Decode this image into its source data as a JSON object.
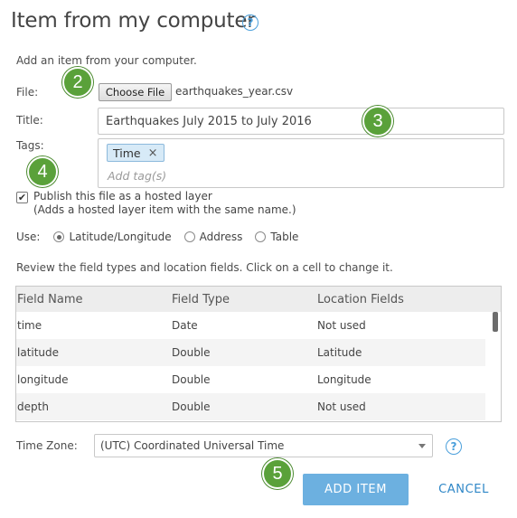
{
  "dialog": {
    "title": "Item from my computer",
    "help_glyph": "?",
    "intro": "Add an item from your computer."
  },
  "file": {
    "label": "File:",
    "button_label": "Choose File",
    "file_name": "earthquakes_year.csv"
  },
  "title_field": {
    "label": "Title:",
    "value": "Earthquakes July 2015 to July 2016"
  },
  "tags": {
    "label": "Tags:",
    "items": [
      {
        "label": "Time",
        "remove_glyph": "×"
      }
    ],
    "placeholder": "Add tag(s)"
  },
  "publish": {
    "checked": true,
    "check_glyph": "✔",
    "line1": "Publish this file as a hosted layer",
    "line2": "(Adds a hosted layer item with the same name.)"
  },
  "use": {
    "label": "Use:",
    "options": [
      {
        "label": "Latitude/Longitude",
        "selected": true
      },
      {
        "label": "Address",
        "selected": false
      },
      {
        "label": "Table",
        "selected": false
      }
    ]
  },
  "review_text": "Review the field types and location fields. Click on a cell to change it.",
  "fields_table": {
    "columns": [
      "Field Name",
      "Field Type",
      "Location Fields"
    ],
    "rows": [
      [
        "time",
        "Date",
        "Not used"
      ],
      [
        "latitude",
        "Double",
        "Latitude"
      ],
      [
        "longitude",
        "Double",
        "Longitude"
      ],
      [
        "depth",
        "Double",
        "Not used"
      ]
    ]
  },
  "time_zone": {
    "label": "Time Zone:",
    "selected": "(UTC) Coordinated Universal Time"
  },
  "actions": {
    "add_label": "ADD ITEM",
    "cancel_label": "CANCEL"
  },
  "step_badges": [
    "2",
    "3",
    "4",
    "5"
  ],
  "colors": {
    "accent": "#4a9fdb",
    "primary_button": "#6cb0e0",
    "badge_green": "#5aa13a",
    "link_blue": "#2f87c7"
  }
}
